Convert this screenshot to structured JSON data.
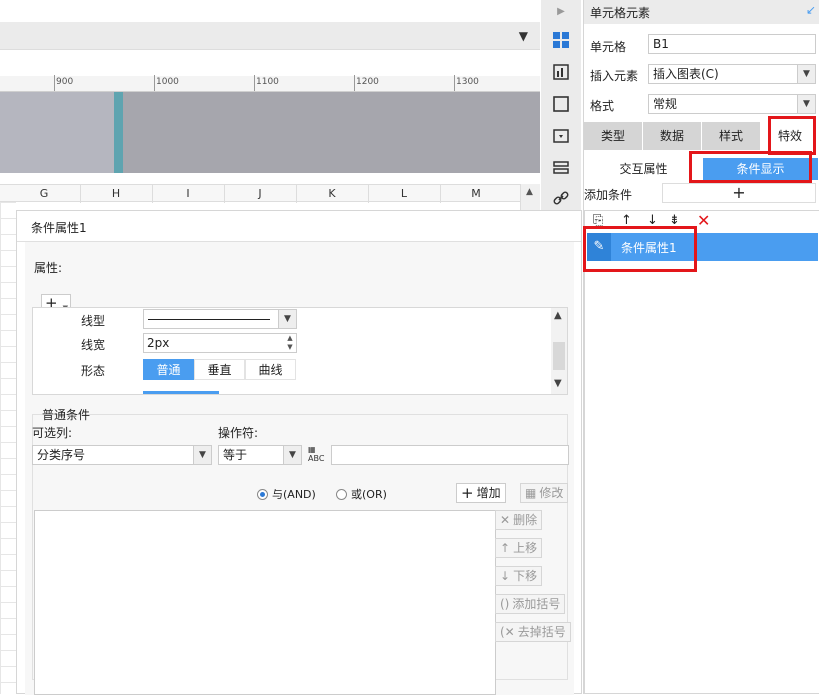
{
  "ruler": {
    "ticks": [
      "900",
      "1000",
      "1100",
      "1200",
      "1300"
    ]
  },
  "sheet": {
    "columns": [
      "G",
      "H",
      "I",
      "J",
      "K",
      "L",
      "M"
    ]
  },
  "icons": {
    "toolbar_collapse": "filter-collapse-icon",
    "strip": [
      "cell-grid-icon",
      "chart-settings-icon",
      "frame-icon",
      "widget-icon",
      "element-list-icon",
      "link-icon"
    ]
  },
  "dialog": {
    "title": "条件属性1",
    "properties": {
      "group_label": "属性:",
      "add_button": "+",
      "rows": {
        "linetype_label": "线型",
        "linewidth_label": "线宽",
        "linewidth_value": "2px",
        "shape_label": "形态",
        "shape_options": [
          "普通",
          "垂直",
          "曲线"
        ],
        "shape_selected": "普通"
      }
    },
    "condition": {
      "group_label": "普通条件",
      "column_label": "可选列:",
      "column_value": "分类序号",
      "operator_label": "操作符:",
      "operator_value": "等于",
      "value_input": "",
      "radio_and": "与(AND)",
      "radio_or": "或(OR)",
      "radio_selected": "and",
      "buttons": {
        "add": "增加",
        "modify": "修改",
        "delete": "删除",
        "move_up": "上移",
        "move_down": "下移",
        "add_bracket": "添加括号",
        "remove_bracket": "去掉括号"
      }
    }
  },
  "panel": {
    "title": "单元格元素",
    "cell_label": "单元格",
    "cell_value": "B1",
    "insert_label": "插入元素",
    "insert_value": "插入图表(C)",
    "format_label": "格式",
    "format_value": "常规",
    "tabs": [
      "类型",
      "数据",
      "样式",
      "特效"
    ],
    "active_tab": "特效",
    "subtabs": [
      "交互属性",
      "条件显示"
    ],
    "active_subtab": "条件显示",
    "add_condition_label": "添加条件",
    "add_condition_button": "+",
    "condition_items": [
      {
        "label": "条件属性1"
      }
    ]
  },
  "colors": {
    "accent": "#4a9df0",
    "highlight": "#e3161a",
    "delete_red": "#e3161a"
  }
}
